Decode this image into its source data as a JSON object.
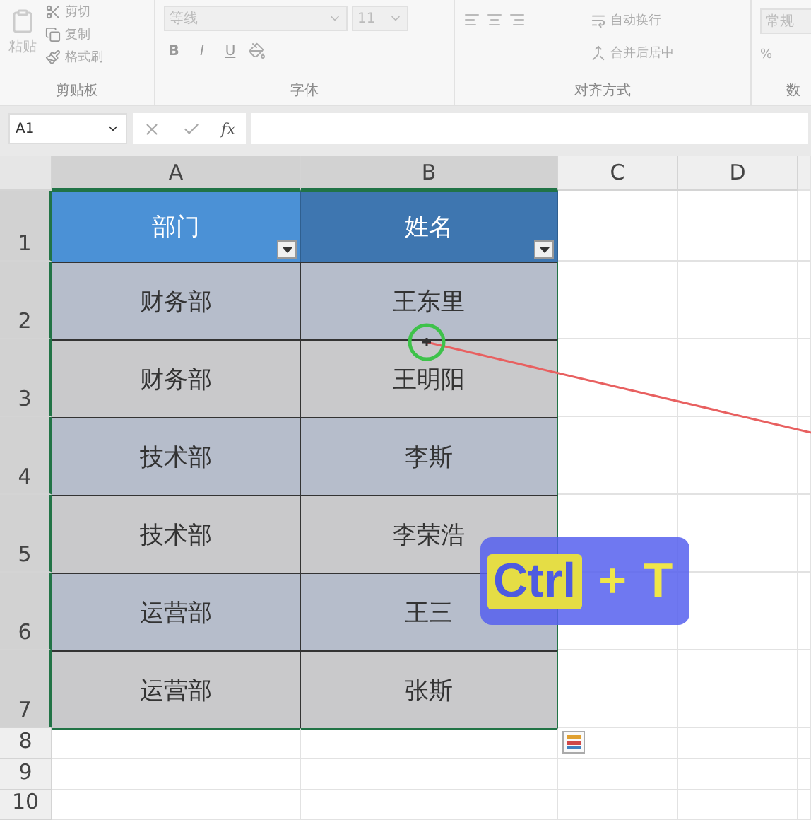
{
  "ribbon": {
    "groups": [
      {
        "kind": "clipboard",
        "label": "剪贴板",
        "paste": "粘贴",
        "items": [
          "剪切",
          "复制",
          "格式刷"
        ]
      },
      {
        "kind": "font",
        "label": "字体",
        "font_name": "等线",
        "font_size": "11",
        "styles": [
          "B",
          "I",
          "U"
        ]
      },
      {
        "kind": "alignment",
        "label": "对齐方式",
        "items": [
          "自动换行",
          "合并后居中"
        ]
      },
      {
        "kind": "number",
        "label": "数",
        "format": "常规",
        "percent": "%"
      }
    ]
  },
  "formula_bar": {
    "name_box": "A1",
    "fx": "fx"
  },
  "columns": [
    {
      "label": "A",
      "selected": true
    },
    {
      "label": "B",
      "selected": true
    },
    {
      "label": "C",
      "selected": false
    },
    {
      "label": "D",
      "selected": false
    }
  ],
  "table": {
    "header": [
      "部门",
      "姓名"
    ],
    "rows": [
      {
        "row": "2",
        "cells": [
          "财务部",
          "王东里"
        ]
      },
      {
        "row": "3",
        "cells": [
          "财务部",
          "王明阳"
        ]
      },
      {
        "row": "4",
        "cells": [
          "技术部",
          "李斯"
        ]
      },
      {
        "row": "5",
        "cells": [
          "技术部",
          "李荣浩"
        ]
      },
      {
        "row": "6",
        "cells": [
          "运营部",
          "王三"
        ]
      },
      {
        "row": "7",
        "cells": [
          "运营部",
          "张斯"
        ]
      }
    ]
  },
  "header_row": "1",
  "empty_rows": [
    "8",
    "9",
    "10"
  ],
  "shortcut": {
    "keys": [
      "Ctrl",
      "+",
      "T"
    ]
  }
}
